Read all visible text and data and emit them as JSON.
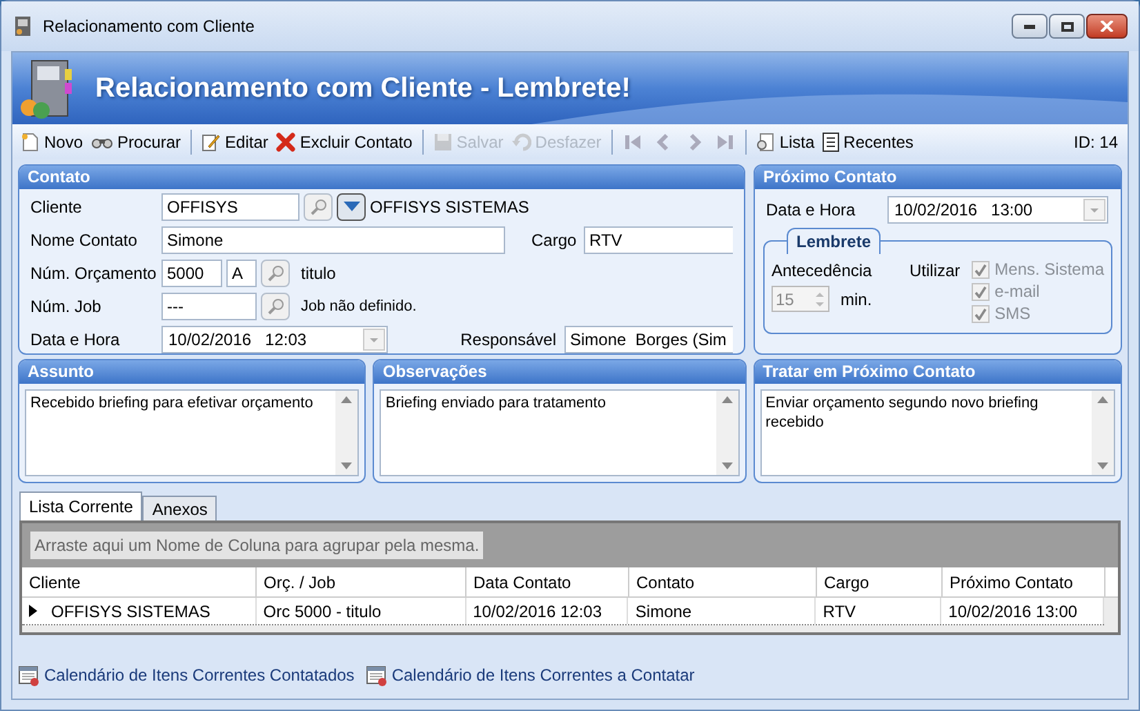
{
  "window": {
    "title": "Relacionamento com Cliente"
  },
  "banner": {
    "title": "Relacionamento com Cliente - Lembrete!"
  },
  "toolbar": {
    "groups": [
      [
        {
          "label": "Novo",
          "disabled": false
        },
        {
          "label": "Procurar",
          "disabled": false
        }
      ],
      [
        {
          "label": "Editar",
          "disabled": false
        },
        {
          "label": "Excluir Contato",
          "disabled": false
        }
      ],
      [
        {
          "label": "Salvar",
          "disabled": true
        },
        {
          "label": "Desfazer",
          "disabled": true
        }
      ],
      [
        {
          "label": "Lista",
          "disabled": false
        },
        {
          "label": "Recentes",
          "disabled": false
        }
      ]
    ],
    "id_label": "ID: 14"
  },
  "contato": {
    "title": "Contato",
    "cliente": {
      "label": "Cliente",
      "code": "OFFISYS",
      "name": "OFFISYS SISTEMAS"
    },
    "nome_contato": {
      "label": "Nome Contato",
      "value": "Simone"
    },
    "cargo": {
      "label": "Cargo",
      "value": "RTV"
    },
    "orcamento": {
      "label": "Núm. Orçamento",
      "number": "5000",
      "letter": "A",
      "title": "titulo"
    },
    "job": {
      "label": "Núm. Job",
      "number": "---",
      "note": "Job não definido."
    },
    "data_hora": {
      "label": "Data e Hora",
      "value": "10/02/2016   12:03"
    },
    "responsavel": {
      "label": "Responsável",
      "value": "Simone  Borges (Sim"
    }
  },
  "proximo_contato": {
    "title": "Próximo Contato",
    "data_hora": {
      "label": "Data e Hora",
      "value": "10/02/2016   13:00"
    },
    "lembrete": {
      "title": "Lembrete",
      "antecedencia_label": "Antecedência",
      "minutes": "15",
      "unit": "min.",
      "utilizar_label": "Utilizar",
      "options": [
        {
          "label": "Mens. Sistema",
          "checked": true,
          "disabled": true
        },
        {
          "label": "e-mail",
          "checked": true,
          "disabled": true
        },
        {
          "label": "SMS",
          "checked": true,
          "disabled": true
        }
      ]
    }
  },
  "memos": [
    {
      "title": "Assunto",
      "text": "Recebido briefing para efetivar orçamento"
    },
    {
      "title": "Observações",
      "text": "Briefing enviado para tratamento"
    },
    {
      "title": "Tratar em Próximo Contato",
      "text": "Enviar orçamento segundo novo briefing recebido"
    }
  ],
  "tabs": [
    {
      "label": "Lista Corrente",
      "selected": true
    },
    {
      "label": "Anexos",
      "selected": false
    }
  ],
  "grid": {
    "group_hint": "Arraste aqui um Nome de Coluna para agrupar pela mesma.",
    "columns": [
      "Cliente",
      "Orç. / Job",
      "Data Contato",
      "Contato",
      "Cargo",
      "Próximo Contato"
    ],
    "rows": [
      {
        "current": true,
        "cells": [
          "OFFISYS SISTEMAS",
          "Orc 5000 - titulo",
          "10/02/2016 12:03",
          "Simone",
          "RTV",
          "10/02/2016 13:00"
        ]
      }
    ]
  },
  "footer_links": [
    "Calendário de Itens Correntes Contatados",
    "Calendário de Itens Correntes a Contatar"
  ]
}
